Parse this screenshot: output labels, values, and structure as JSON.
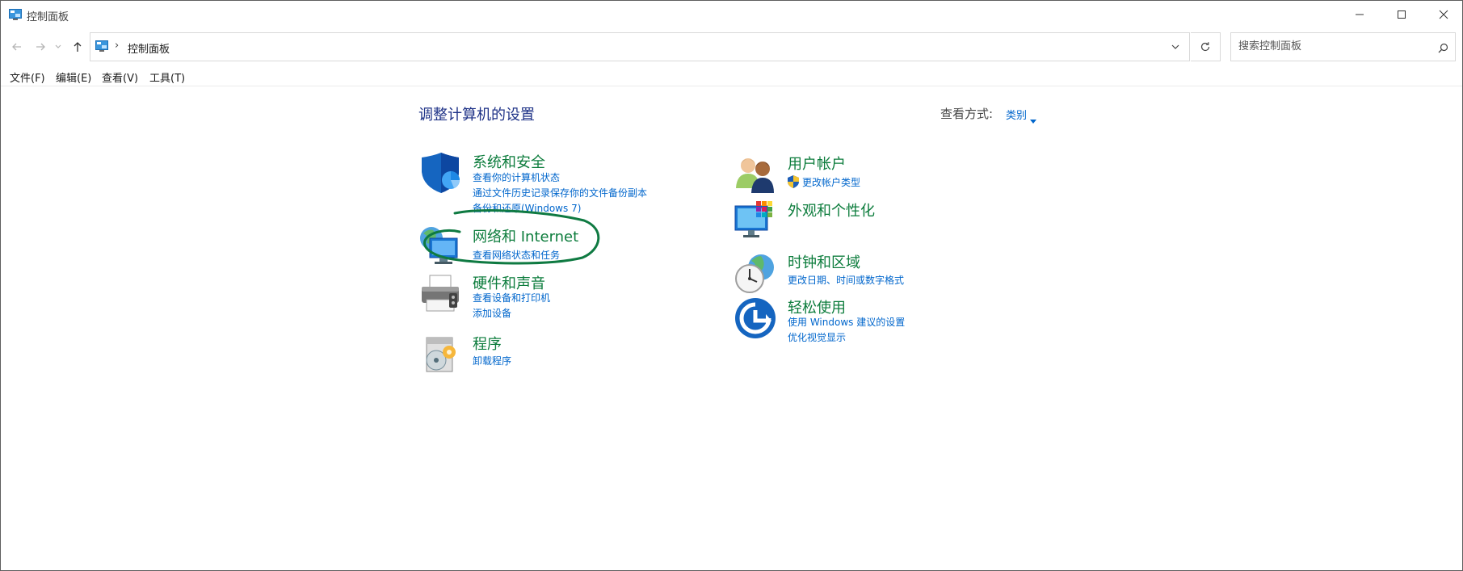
{
  "window": {
    "title": "控制面板"
  },
  "address_bar": {
    "separator": "›",
    "crumb": "控制面板"
  },
  "search": {
    "placeholder": "搜索控制面板"
  },
  "menu": {
    "items": [
      "文件(F)",
      "编辑(E)",
      "查看(V)",
      "工具(T)"
    ]
  },
  "content": {
    "title": "调整计算机的设置",
    "view_label": "查看方式:",
    "view_value": "类别"
  },
  "categories": [
    {
      "title": "系统和安全",
      "icon": "shield-icon",
      "links": [
        "查看你的计算机状态",
        "通过文件历史记录保存你的文件备份副本",
        "备份和还原(Windows 7)"
      ]
    },
    {
      "title": "网络和 Internet",
      "icon": "network-globe-icon",
      "links": [
        "查看网络状态和任务"
      ]
    },
    {
      "title": "硬件和声音",
      "icon": "printer-icon",
      "links": [
        "查看设备和打印机",
        "添加设备"
      ]
    },
    {
      "title": "程序",
      "icon": "programs-disc-icon",
      "links": [
        "卸载程序"
      ]
    },
    {
      "title": "用户帐户",
      "icon": "users-icon",
      "links": [
        "更改帐户类型"
      ]
    },
    {
      "title": "外观和个性化",
      "icon": "monitor-icon",
      "links": []
    },
    {
      "title": "时钟和区域",
      "icon": "clock-globe-icon",
      "links": [
        "更改日期、时间或数字格式"
      ]
    },
    {
      "title": "轻松使用",
      "icon": "ease-of-access-icon",
      "links": [
        "使用 Windows 建议的设置",
        "优化视觉显示"
      ]
    }
  ],
  "colors": {
    "category_title": "#0c7c3c",
    "link": "#0066cc",
    "page_title": "#1e3287",
    "annotation_stroke": "#0f7a42"
  }
}
